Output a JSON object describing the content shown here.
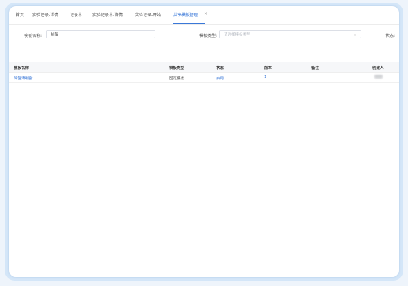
{
  "tabs": [
    {
      "label": "首页"
    },
    {
      "label": "实验记录-详情"
    },
    {
      "label": "记录本"
    },
    {
      "label": "实验记录本-详情"
    },
    {
      "label": "实验记录-开始"
    },
    {
      "label": "共享模板管理",
      "active": true
    }
  ],
  "close_glyph": "×",
  "filters": {
    "template_name": {
      "label": "模板名称:",
      "value": "制备"
    },
    "template_type": {
      "label": "模板类型:",
      "placeholder": "请选择模板类型"
    },
    "status": {
      "label": "状态:"
    }
  },
  "table": {
    "columns": [
      "模板名称",
      "模板类型",
      "状态",
      "版本",
      "备注",
      "创建人"
    ],
    "rows": [
      {
        "name": "储备液制备",
        "type": "固定模板",
        "status": "启用",
        "version": "1",
        "remark": "",
        "creator": ""
      }
    ]
  },
  "colors": {
    "accent": "#3a78d8",
    "frame": "#d4e6f8"
  }
}
